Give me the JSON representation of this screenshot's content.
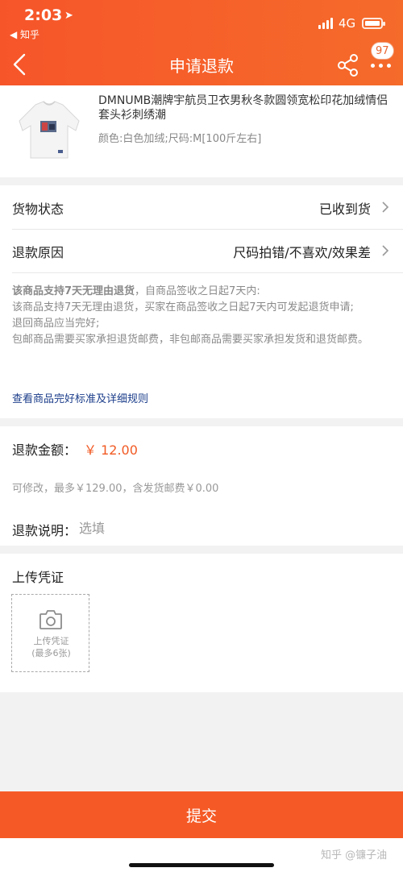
{
  "status_bar": {
    "time": "2:03",
    "back_app": "◀ 知乎",
    "network": "4G"
  },
  "nav": {
    "title": "申请退款",
    "badge": "97",
    "icons": [
      "back-arrow-icon",
      "share-icon",
      "more-icon"
    ]
  },
  "product": {
    "title": "DMNUMB潮牌宇航员卫衣男秋冬款圆领宽松印花加绒情侣套头衫刺绣潮",
    "spec": "颜色:白色加绒;尺码:M[100斤左右]"
  },
  "form": {
    "goods_status_label": "货物状态",
    "goods_status_value": "已收到货",
    "refund_reason_label": "退款原因",
    "refund_reason_value": "尺码拍错/不喜欢/效果差"
  },
  "policy": {
    "bold": "该商品支持7天无理由退货",
    "line1_rest": "，自商品签收之日起7天内:",
    "line2": "该商品支持7天无理由退货，买家在商品签收之日起7天内可发起退货申请;",
    "line3": "退回商品应当完好;",
    "line4": "包邮商品需要买家承担退货邮费，非包邮商品需要买家承担发货和退货邮费。",
    "link": "查看商品完好标准及详细规则"
  },
  "refund": {
    "amount_label": "退款金额：",
    "amount_value": "￥ 12.00",
    "hint": "可修改，最多￥129.00，含发货邮费￥0.00",
    "remark_label": "退款说明：",
    "remark_placeholder": "选填"
  },
  "upload": {
    "title": "上传凭证",
    "box_label_1": "上传凭证",
    "box_label_2": "(最多6张)"
  },
  "submit_label": "提交",
  "watermark": "知乎 @镰子油",
  "colors": {
    "accent": "#f55a26",
    "price": "#f15a24",
    "link": "#1b3d8a"
  }
}
